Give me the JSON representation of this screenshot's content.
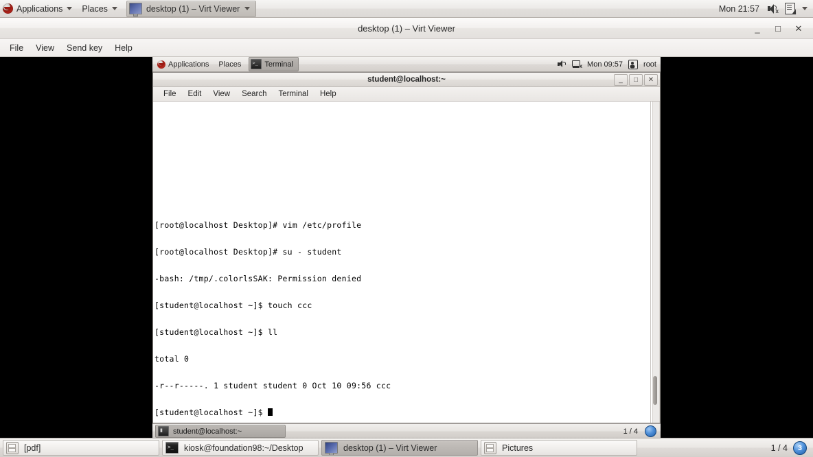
{
  "host_panel": {
    "applications_label": "Applications",
    "places_label": "Places",
    "window_button_label": "desktop (1) – Virt Viewer",
    "clock": "Mon 21:57",
    "icons": [
      "fedora-logo",
      "speaker-mute-icon",
      "document-bolt-icon",
      "chevron-down-icon"
    ]
  },
  "virt_viewer": {
    "title": "desktop (1) – Virt Viewer",
    "menu": [
      "File",
      "View",
      "Send key",
      "Help"
    ],
    "window_buttons": {
      "minimize": "_",
      "maximize": "□",
      "close": "✕"
    }
  },
  "vm_top_panel": {
    "applications_label": "Applications",
    "places_label": "Places",
    "window_button_label": "Terminal",
    "clock": "Mon 09:57",
    "user": "root"
  },
  "terminal": {
    "title": "student@localhost:~",
    "menu": [
      "File",
      "Edit",
      "View",
      "Search",
      "Terminal",
      "Help"
    ],
    "window_buttons": {
      "minimize": "_",
      "maximize": "□",
      "close": "✕"
    },
    "lines": [
      "[root@localhost Desktop]# vim /etc/profile",
      "[root@localhost Desktop]# su - student",
      "-bash: /tmp/.colorlsSAK: Permission denied",
      "[student@localhost ~]$ touch ccc",
      "[student@localhost ~]$ ll",
      "total 0",
      "-r--r-----. 1 student student 0 Oct 10 09:56 ccc"
    ],
    "prompt": "[student@localhost ~]$ "
  },
  "vm_bottom_panel": {
    "window_button_label": "student@localhost:~",
    "workspace": "1 / 4",
    "badge": ""
  },
  "host_taskbar": {
    "buttons": [
      {
        "label": "[pdf]",
        "icon": "pdf-icon",
        "active": false
      },
      {
        "label": "kiosk@foundation98:~/Desktop",
        "icon": "terminal-icon",
        "active": false
      },
      {
        "label": "desktop (1) – Virt Viewer",
        "icon": "virt-viewer-icon",
        "active": true
      },
      {
        "label": "Pictures",
        "icon": "pictures-icon",
        "active": false
      }
    ],
    "workspace": "1 / 4",
    "badge": "3"
  },
  "colors": {
    "panel_bg": "#e8e5e2",
    "terminal_bg": "#ffffff",
    "terminal_fg": "#000000",
    "desktop_bg": "#000000",
    "badge_blue": "#1d5ba5"
  }
}
